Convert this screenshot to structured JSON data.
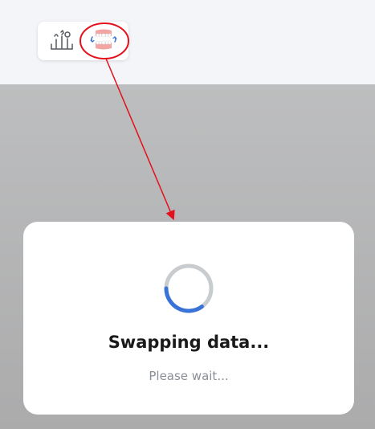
{
  "toolbar": {
    "items": [
      {
        "icon": "dental-tools-icon"
      },
      {
        "icon": "swap-jaws-icon"
      }
    ]
  },
  "dialog": {
    "title": "Swapping data...",
    "subtitle": "Please wait...",
    "progress_fraction": 0.35
  },
  "colors": {
    "spinner_track": "#c9cccf",
    "spinner_arc": "#3a73d8",
    "annotation": "#e3111b",
    "overlay": "#b3b4b5",
    "top_background": "#f4f5f9"
  }
}
